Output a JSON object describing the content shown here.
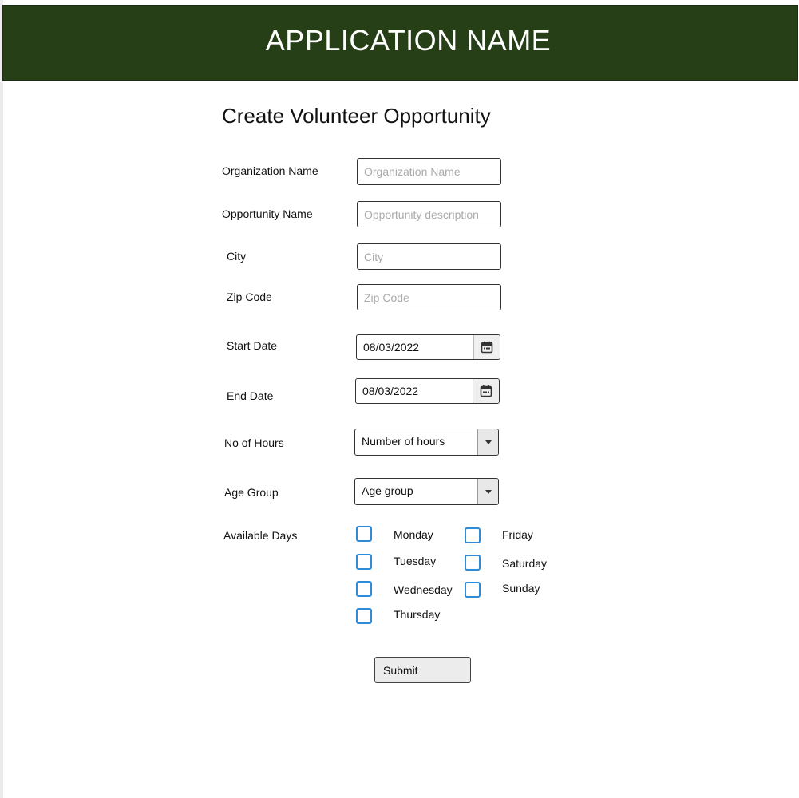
{
  "header": {
    "app_name": "APPLICATION NAME"
  },
  "form": {
    "title": "Create Volunteer Opportunity",
    "organization_name": {
      "label": "Organization Name",
      "placeholder": "Organization Name",
      "value": ""
    },
    "opportunity_name": {
      "label": "Opportunity Name",
      "placeholder": "Opportunity description",
      "value": ""
    },
    "city": {
      "label": "City",
      "placeholder": "City",
      "value": ""
    },
    "zip_code": {
      "label": "Zip Code",
      "placeholder": "Zip Code",
      "value": ""
    },
    "start_date": {
      "label": "Start Date",
      "value": "08/03/2022",
      "icon": "calendar-icon"
    },
    "end_date": {
      "label": "End Date",
      "value": "08/03/2022",
      "icon": "calendar-icon"
    },
    "hours": {
      "label": "No of Hours",
      "selected": "Number of hours",
      "icon": "caret-down-icon"
    },
    "age_group": {
      "label": "Age Group",
      "selected": "Age group",
      "icon": "caret-down-icon"
    },
    "available_days": {
      "label": "Available Days",
      "days": [
        {
          "name": "Monday",
          "checked": false
        },
        {
          "name": "Tuesday",
          "checked": false
        },
        {
          "name": "Wednesday",
          "checked": false
        },
        {
          "name": "Thursday",
          "checked": false
        },
        {
          "name": "Friday",
          "checked": false
        },
        {
          "name": "Saturday",
          "checked": false
        },
        {
          "name": "Sunday",
          "checked": false
        }
      ]
    },
    "submit_label": "Submit"
  },
  "colors": {
    "header_bg": "#263f17",
    "checkbox_border": "#2f8ad8"
  }
}
